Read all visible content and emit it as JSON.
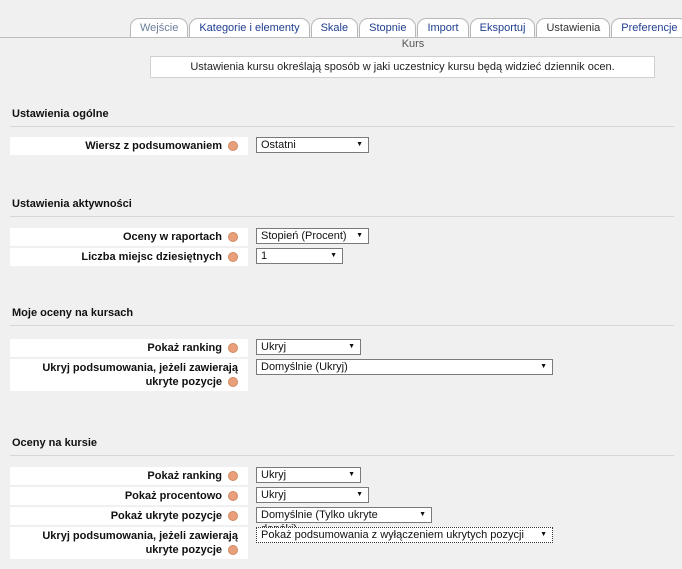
{
  "tabs": [
    "Wejście",
    "Kategorie i elementy",
    "Skale",
    "Stopnie",
    "Import",
    "Eksportuj",
    "Ustawienia",
    "Preferencje"
  ],
  "subtab": "Kurs",
  "info": "Ustawienia kursu określają sposób w jaki uczestnicy kursu będą widzieć dziennik ocen.",
  "sections": {
    "general": {
      "title": "Ustawienia ogólne",
      "aggregation_label": "Wiersz z podsumowaniem",
      "aggregation_value": "Ostatni"
    },
    "activity": {
      "title": "Ustawienia aktywności",
      "grade_display_label": "Oceny w raportach",
      "grade_display_value": "Stopień (Procent)",
      "decimals_label": "Liczba miejsc dziesiętnych",
      "decimals_value": "1"
    },
    "mygrades": {
      "title": "Moje oceny na kursach",
      "rank_label": "Pokaż ranking",
      "rank_value": "Ukryj",
      "hide_totals_label": "Ukryj podsumowania, jeżeli zawierają ukryte pozycje",
      "hide_totals_value": "Domyślnie (Ukryj)"
    },
    "coursegrades": {
      "title": "Oceny na kursie",
      "rank_label": "Pokaż ranking",
      "rank_value": "Ukryj",
      "percent_label": "Pokaż procentowo",
      "percent_value": "Ukryj",
      "hidden_label": "Pokaż ukryte pozycje",
      "hidden_value": "Domyślnie (Tylko ukryte dopóki)",
      "hide_totals_label": "Ukryj podsumowania, jeżeli zawierają ukryte pozycje",
      "hide_totals_value": "Pokaż podsumowania z wyłączeniem ukrytych pozycji"
    }
  }
}
